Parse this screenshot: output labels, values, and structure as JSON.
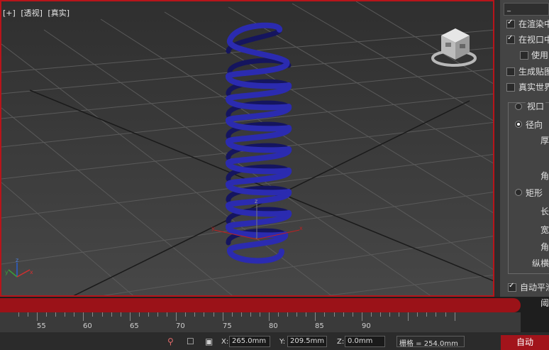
{
  "viewport": {
    "labels": [
      "[+]",
      "[透视]",
      "[真实]"
    ],
    "accent": "#b8141a",
    "object_color": "#2a2aa8"
  },
  "panel": {
    "top": "_",
    "check_render": "在渲染中",
    "check_viewport": "在视口中",
    "check_use": "使用",
    "check_mapping": "生成贴图",
    "check_realworld": "真实世界",
    "radio_viewport": "视口",
    "radio_radial": "径向",
    "label_thickness": "厚",
    "label_angle": "角",
    "radio_rect": "矩形",
    "label_length": "长",
    "label_width": "宽",
    "label_angle2": "角",
    "label_aspect": "纵横",
    "check_autosmooth": "自动平滑",
    "label_threshold": "阈"
  },
  "ruler": {
    "labels": [
      "55",
      "60",
      "65",
      "70",
      "75",
      "80",
      "85",
      "90"
    ]
  },
  "status": {
    "x_label": "X:",
    "x_value": "265.0mm",
    "y_label": "Y:",
    "y_value": "209.5mm",
    "z_label": "Z:",
    "z_value": "0.0mm",
    "grid_text": "栅格 = 254.0mm",
    "auto_label": "自动"
  }
}
